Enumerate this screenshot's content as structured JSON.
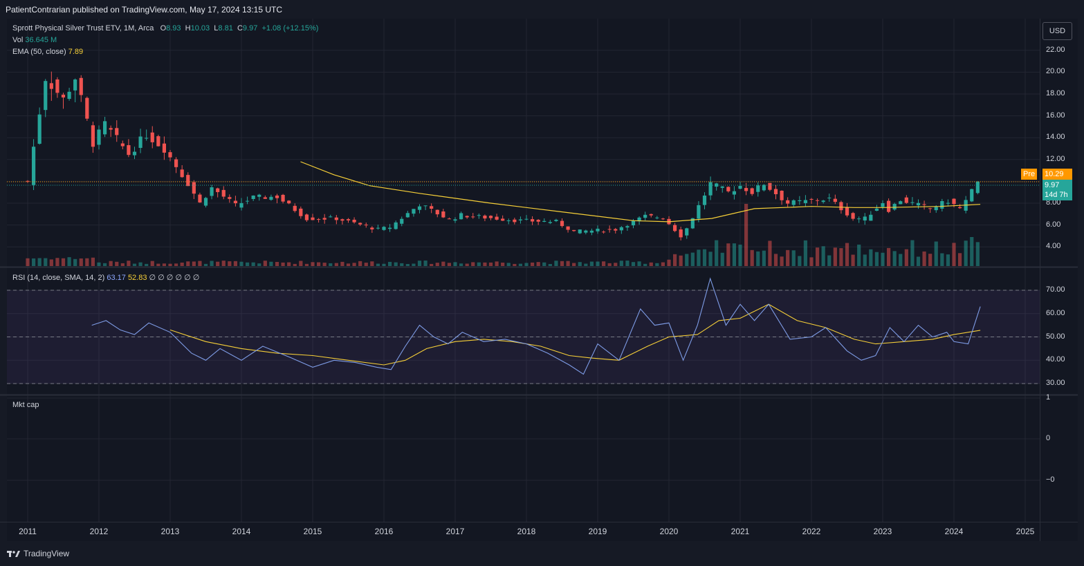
{
  "header": {
    "published": "PatientContrarian published on TradingView.com, May 17, 2024 13:15 UTC"
  },
  "legend": {
    "title": "Sprott Physical Silver Trust ETV, 1M, Arca",
    "o_label": "O",
    "o_value": "8.93",
    "h_label": "H",
    "h_value": "10.03",
    "l_label": "L",
    "l_value": "8.81",
    "c_label": "C",
    "c_value": "9.97",
    "change": "+1.08 (+12.15%)",
    "vol_label": "Vol",
    "vol_value": "36.645 M",
    "ema_label": "EMA (50, close)",
    "ema_value": "7.89",
    "rsi_label": "RSI (14, close, SMA, 14, 2)",
    "rsi_value": "63.17",
    "rsi_sma_value": "52.83",
    "rsi_extra": "∅ ∅ ∅ ∅ ∅ ∅",
    "mktcap_label": "Mkt cap"
  },
  "currency_button": "USD",
  "price_tags": {
    "pre_label": "Pre",
    "pre_value": "10.29",
    "last_value": "9.97",
    "countdown": "14d 7h"
  },
  "colors": {
    "up": "#26a69a",
    "down": "#ef5350",
    "ema": "#f7d038",
    "rsi": "#7e9ce6",
    "rsi_sma": "#f7d038",
    "pre": "#ff9800"
  },
  "footer": {
    "brand": "TradingView"
  },
  "chart_data": [
    {
      "type": "candlestick",
      "title": "Sprott Physical Silver Trust ETV, 1M, Arca",
      "x_axis": [
        "2011",
        "2012",
        "2013",
        "2014",
        "2015",
        "2016",
        "2017",
        "2018",
        "2019",
        "2020",
        "2021",
        "2022",
        "2023",
        "2024",
        "2025"
      ],
      "y_ticks": [
        "22.00",
        "20.00",
        "18.00",
        "16.00",
        "14.00",
        "12.00",
        "8.00",
        "6.00",
        "4.00"
      ],
      "ylim": [
        2.6,
        23.4
      ],
      "anchors": [
        [
          "2011-01",
          10.0
        ],
        [
          "2011-04",
          19.5
        ],
        [
          "2011-07",
          17.5
        ],
        [
          "2011-09",
          19.5
        ],
        [
          "2011-12",
          13.5
        ],
        [
          "2012-02",
          15.2
        ],
        [
          "2012-06",
          12.5
        ],
        [
          "2012-09",
          14.3
        ],
        [
          "2012-12",
          13.0
        ],
        [
          "2013-04",
          9.8
        ],
        [
          "2013-06",
          8.0
        ],
        [
          "2013-08",
          9.4
        ],
        [
          "2013-12",
          7.8
        ],
        [
          "2014-03",
          8.5
        ],
        [
          "2014-07",
          8.6
        ],
        [
          "2014-12",
          6.6
        ],
        [
          "2015-05",
          6.6
        ],
        [
          "2015-12",
          5.6
        ],
        [
          "2016-02",
          5.8
        ],
        [
          "2016-07",
          7.9
        ],
        [
          "2016-12",
          6.5
        ],
        [
          "2017-02",
          6.9
        ],
        [
          "2017-12",
          6.4
        ],
        [
          "2018-06",
          6.3
        ],
        [
          "2018-09",
          5.4
        ],
        [
          "2019-04",
          5.6
        ],
        [
          "2019-09",
          6.8
        ],
        [
          "2019-12",
          6.7
        ],
        [
          "2020-03",
          5.0
        ],
        [
          "2020-04",
          5.7
        ],
        [
          "2020-08",
          9.8
        ],
        [
          "2020-11",
          9.0
        ],
        [
          "2021-01",
          9.6
        ],
        [
          "2021-03",
          9.0
        ],
        [
          "2021-05",
          9.8
        ],
        [
          "2021-09",
          8.0
        ],
        [
          "2022-04",
          8.4
        ],
        [
          "2022-08",
          6.6
        ],
        [
          "2022-10",
          6.6
        ],
        [
          "2023-01",
          8.1
        ],
        [
          "2023-02",
          7.4
        ],
        [
          "2023-04",
          8.3
        ],
        [
          "2023-09",
          7.5
        ],
        [
          "2023-12",
          8.2
        ],
        [
          "2024-02",
          7.5
        ],
        [
          "2024-03",
          8.2
        ],
        [
          "2024-05",
          9.97
        ]
      ],
      "ema_start": "2014-11",
      "ema": [
        [
          2014.83,
          11.8
        ],
        [
          2015.3,
          10.6
        ],
        [
          2015.8,
          9.6
        ],
        [
          2016.5,
          8.9
        ],
        [
          2017.5,
          8.0
        ],
        [
          2018.5,
          7.2
        ],
        [
          2019.5,
          6.4
        ],
        [
          2020.0,
          6.3
        ],
        [
          2020.6,
          6.6
        ],
        [
          2021.2,
          7.5
        ],
        [
          2022.0,
          7.7
        ],
        [
          2022.6,
          7.6
        ],
        [
          2023.0,
          7.6
        ],
        [
          2023.8,
          7.7
        ],
        [
          2024.37,
          7.89
        ]
      ],
      "current": {
        "open": 8.93,
        "high": 10.03,
        "low": 8.81,
        "close": 9.97,
        "ema": 7.89,
        "pre": 10.29
      }
    },
    {
      "type": "bar",
      "title": "Vol",
      "last_value": "36.645 M"
    },
    {
      "type": "line",
      "title": "RSI (14, close, SMA, 14, 2)",
      "y_ticks": [
        "70.00",
        "60.00",
        "50.00",
        "40.00",
        "30.00"
      ],
      "ylim": [
        25,
        75
      ],
      "bands": [
        70,
        50,
        30
      ],
      "rsi": [
        [
          2011.9,
          55
        ],
        [
          2012.1,
          57
        ],
        [
          2012.3,
          53
        ],
        [
          2012.5,
          51
        ],
        [
          2012.7,
          56
        ],
        [
          2013.0,
          52
        ],
        [
          2013.3,
          43
        ],
        [
          2013.5,
          40
        ],
        [
          2013.7,
          45
        ],
        [
          2014.0,
          40
        ],
        [
          2014.3,
          46
        ],
        [
          2014.7,
          41
        ],
        [
          2015.0,
          37
        ],
        [
          2015.3,
          40
        ],
        [
          2015.6,
          39
        ],
        [
          2015.9,
          37
        ],
        [
          2016.1,
          36
        ],
        [
          2016.3,
          46
        ],
        [
          2016.5,
          55
        ],
        [
          2016.7,
          50
        ],
        [
          2016.9,
          47
        ],
        [
          2017.1,
          52
        ],
        [
          2017.4,
          48
        ],
        [
          2017.7,
          49
        ],
        [
          2018.0,
          47
        ],
        [
          2018.3,
          43
        ],
        [
          2018.6,
          38
        ],
        [
          2018.8,
          34
        ],
        [
          2019.0,
          47
        ],
        [
          2019.3,
          40
        ],
        [
          2019.6,
          62
        ],
        [
          2019.8,
          55
        ],
        [
          2020.0,
          56
        ],
        [
          2020.2,
          40
        ],
        [
          2020.4,
          55
        ],
        [
          2020.58,
          75
        ],
        [
          2020.8,
          55
        ],
        [
          2021.0,
          64
        ],
        [
          2021.2,
          57
        ],
        [
          2021.4,
          64
        ],
        [
          2021.7,
          49
        ],
        [
          2022.0,
          50
        ],
        [
          2022.2,
          54
        ],
        [
          2022.5,
          44
        ],
        [
          2022.7,
          40
        ],
        [
          2022.9,
          42
        ],
        [
          2023.1,
          54
        ],
        [
          2023.3,
          48
        ],
        [
          2023.5,
          55
        ],
        [
          2023.7,
          50
        ],
        [
          2023.9,
          52
        ],
        [
          2024.0,
          48
        ],
        [
          2024.2,
          47
        ],
        [
          2024.37,
          63
        ]
      ],
      "sma": [
        [
          2013.0,
          53
        ],
        [
          2013.5,
          48
        ],
        [
          2014.0,
          45
        ],
        [
          2014.5,
          43
        ],
        [
          2015.0,
          42
        ],
        [
          2015.5,
          40
        ],
        [
          2016.0,
          38
        ],
        [
          2016.3,
          40
        ],
        [
          2016.6,
          45
        ],
        [
          2017.0,
          48
        ],
        [
          2017.4,
          49
        ],
        [
          2017.8,
          48
        ],
        [
          2018.2,
          46
        ],
        [
          2018.6,
          42
        ],
        [
          2018.9,
          41
        ],
        [
          2019.3,
          40
        ],
        [
          2019.7,
          46
        ],
        [
          2020.0,
          50
        ],
        [
          2020.4,
          51
        ],
        [
          2020.7,
          57
        ],
        [
          2021.0,
          58
        ],
        [
          2021.4,
          64
        ],
        [
          2021.8,
          57
        ],
        [
          2022.2,
          54
        ],
        [
          2022.6,
          49
        ],
        [
          2022.9,
          47
        ],
        [
          2023.3,
          48
        ],
        [
          2023.7,
          49
        ],
        [
          2024.0,
          51
        ],
        [
          2024.37,
          52.83
        ]
      ],
      "current": {
        "rsi": 63.17,
        "sma": 52.83
      }
    },
    {
      "type": "line",
      "title": "Mkt cap",
      "y_ticks": [
        "1",
        "0",
        "−0"
      ]
    }
  ]
}
